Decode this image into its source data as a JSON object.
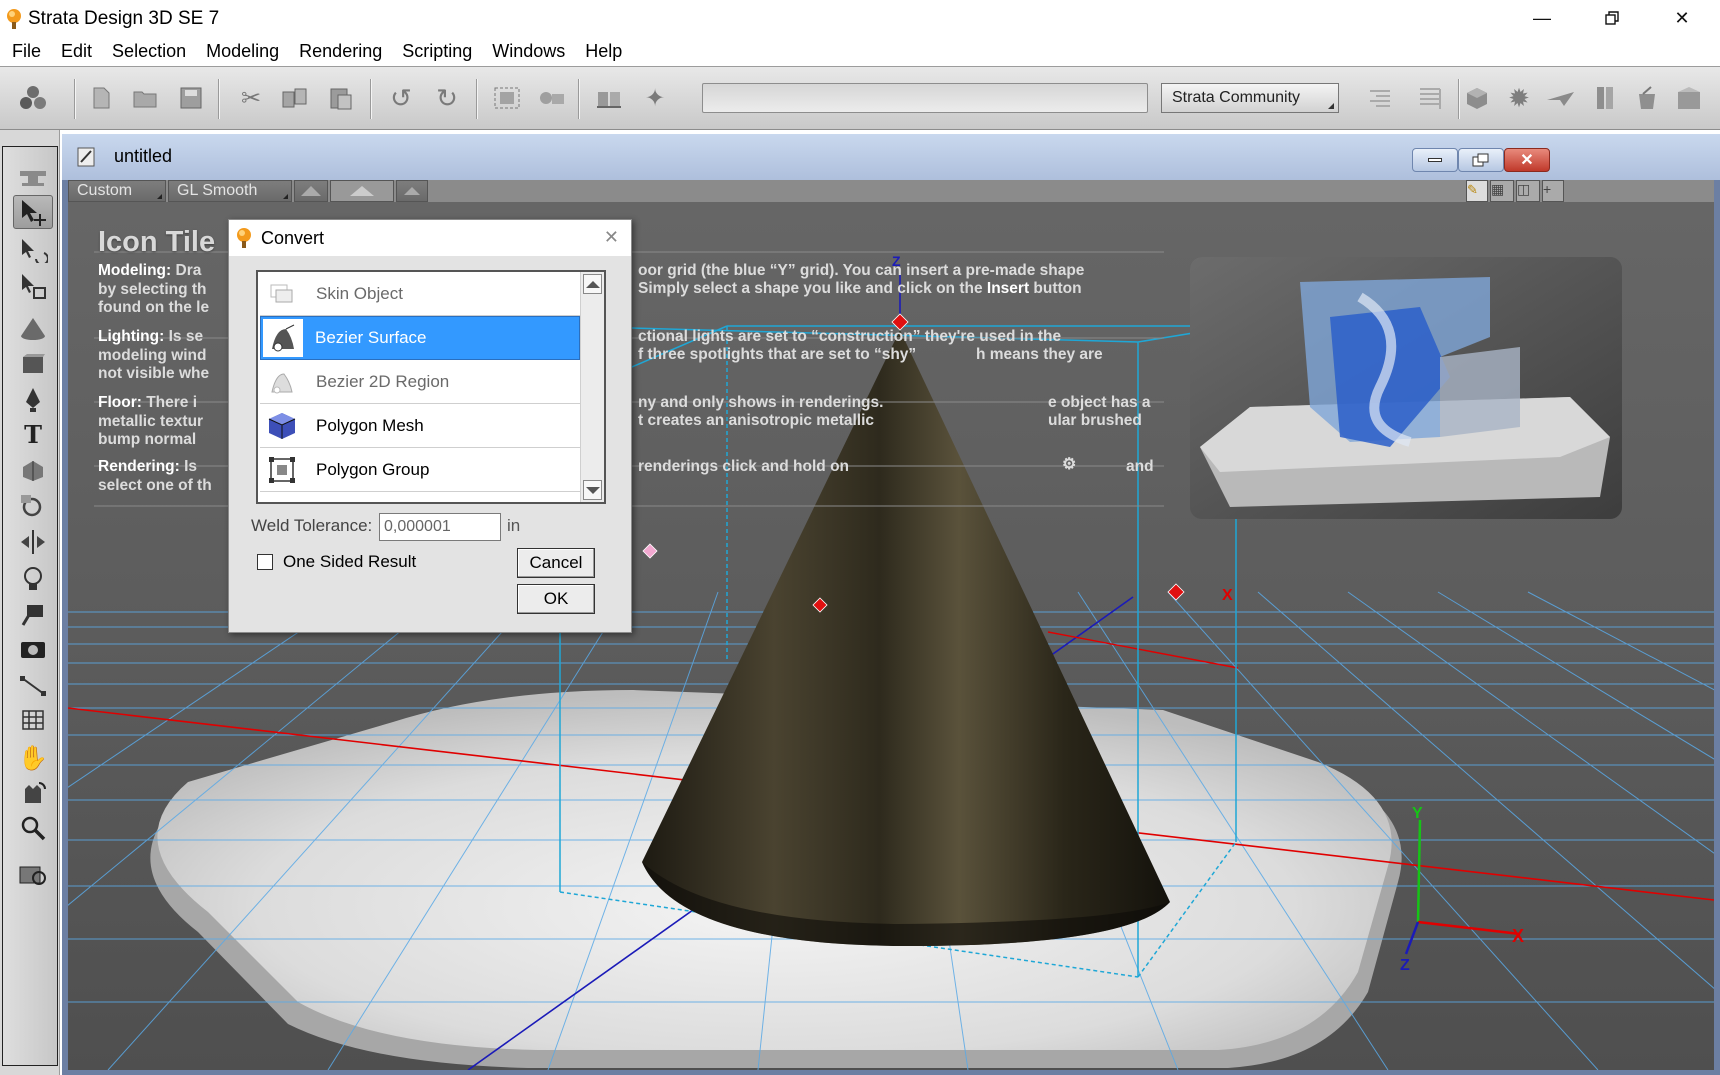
{
  "window": {
    "title": "Strata Design 3D SE 7",
    "controls": [
      "minimize",
      "restore",
      "close"
    ]
  },
  "menu": [
    "File",
    "Edit",
    "Selection",
    "Modeling",
    "Rendering",
    "Scripting",
    "Windows",
    "Help"
  ],
  "toolbar": {
    "community_label": "Strata Community",
    "search_value": ""
  },
  "document": {
    "title": "untitled",
    "view_preset": "Custom",
    "render_mode": "GL Smooth"
  },
  "viewport_text": {
    "heading": "Icon Tile",
    "modeling_label": "Modeling:",
    "modeling_text": "Dra — oor grid (the blue “Y” grid). You can insert a pre-made shape by selecting th — Simply select a shape you like and click on the Insert button found on the le",
    "lighting_label": "Lighting:",
    "lighting_text": "Is se — ctional lights are set to “construction” they're used in the modeling wind — f three spotlights that are set to “shy” h means they are not visible whe",
    "floor_label": "Floor:",
    "floor_text": "There i — ny and only shows in renderings. e object has a metallic textur — t creates an anisotropic metallic ular brushed bump normal",
    "rendering_label": "Rendering:",
    "rendering_text": "Is — renderings click and hold on and select one of th",
    "l1a": "Dra",
    "l1b": "oor grid (the blue “Y” grid). You can insert a pre-made shape",
    "l2a": "by selecting th",
    "l2b": "Simply select a shape you like and click on the",
    "l2c": "Insert",
    "l2d": "button",
    "l3a": "found on the le",
    "lt1a": "Is se",
    "lt1b": "ctional lights are set to “construction” they're used in the",
    "lt2a": "modeling wind",
    "lt2b": "f three spotlights that are set to “shy”",
    "lt2c": "h means they are",
    "lt3a": "not visible whe",
    "f1a": "There i",
    "f1b": "ny and only shows in renderings.",
    "f1c": "e object has a",
    "f2a": "metallic textur",
    "f2b": "t creates an anisotropic metallic",
    "f2c": "ular brushed",
    "f3a": "bump normal",
    "r1a": "Is",
    "r1b": "renderings click and hold on",
    "r1c": "and",
    "r2a": "select one of th"
  },
  "axis_labels": {
    "z_top": "Z",
    "x_mid": "X",
    "y_corner": "Y",
    "x_corner": "X",
    "z_corner": "Z"
  },
  "convert_dialog": {
    "title": "Convert",
    "items": [
      {
        "label": "Skin Object",
        "icon": "skin-object-icon",
        "state": "disabled"
      },
      {
        "label": "Bezier Surface",
        "icon": "bezier-surface-icon",
        "state": "selected"
      },
      {
        "label": "Bezier 2D Region",
        "icon": "bezier-2d-region-icon",
        "state": "disabled"
      },
      {
        "label": "Polygon Mesh",
        "icon": "polygon-mesh-icon",
        "state": "enabled"
      },
      {
        "label": "Polygon Group",
        "icon": "polygon-group-icon",
        "state": "enabled"
      }
    ],
    "weld_label": "Weld Tolerance:",
    "weld_value": "0,000001",
    "weld_unit": "in",
    "one_sided_label": "One Sided Result",
    "one_sided_checked": false,
    "cancel_label": "Cancel",
    "ok_label": "OK"
  },
  "colors": {
    "selection": "#3399ff",
    "doc_titlebar": "#b8c8e4",
    "grid": "#5aa9e6",
    "x_axis": "#e00000",
    "bounding_box": "#1fa7d6"
  }
}
